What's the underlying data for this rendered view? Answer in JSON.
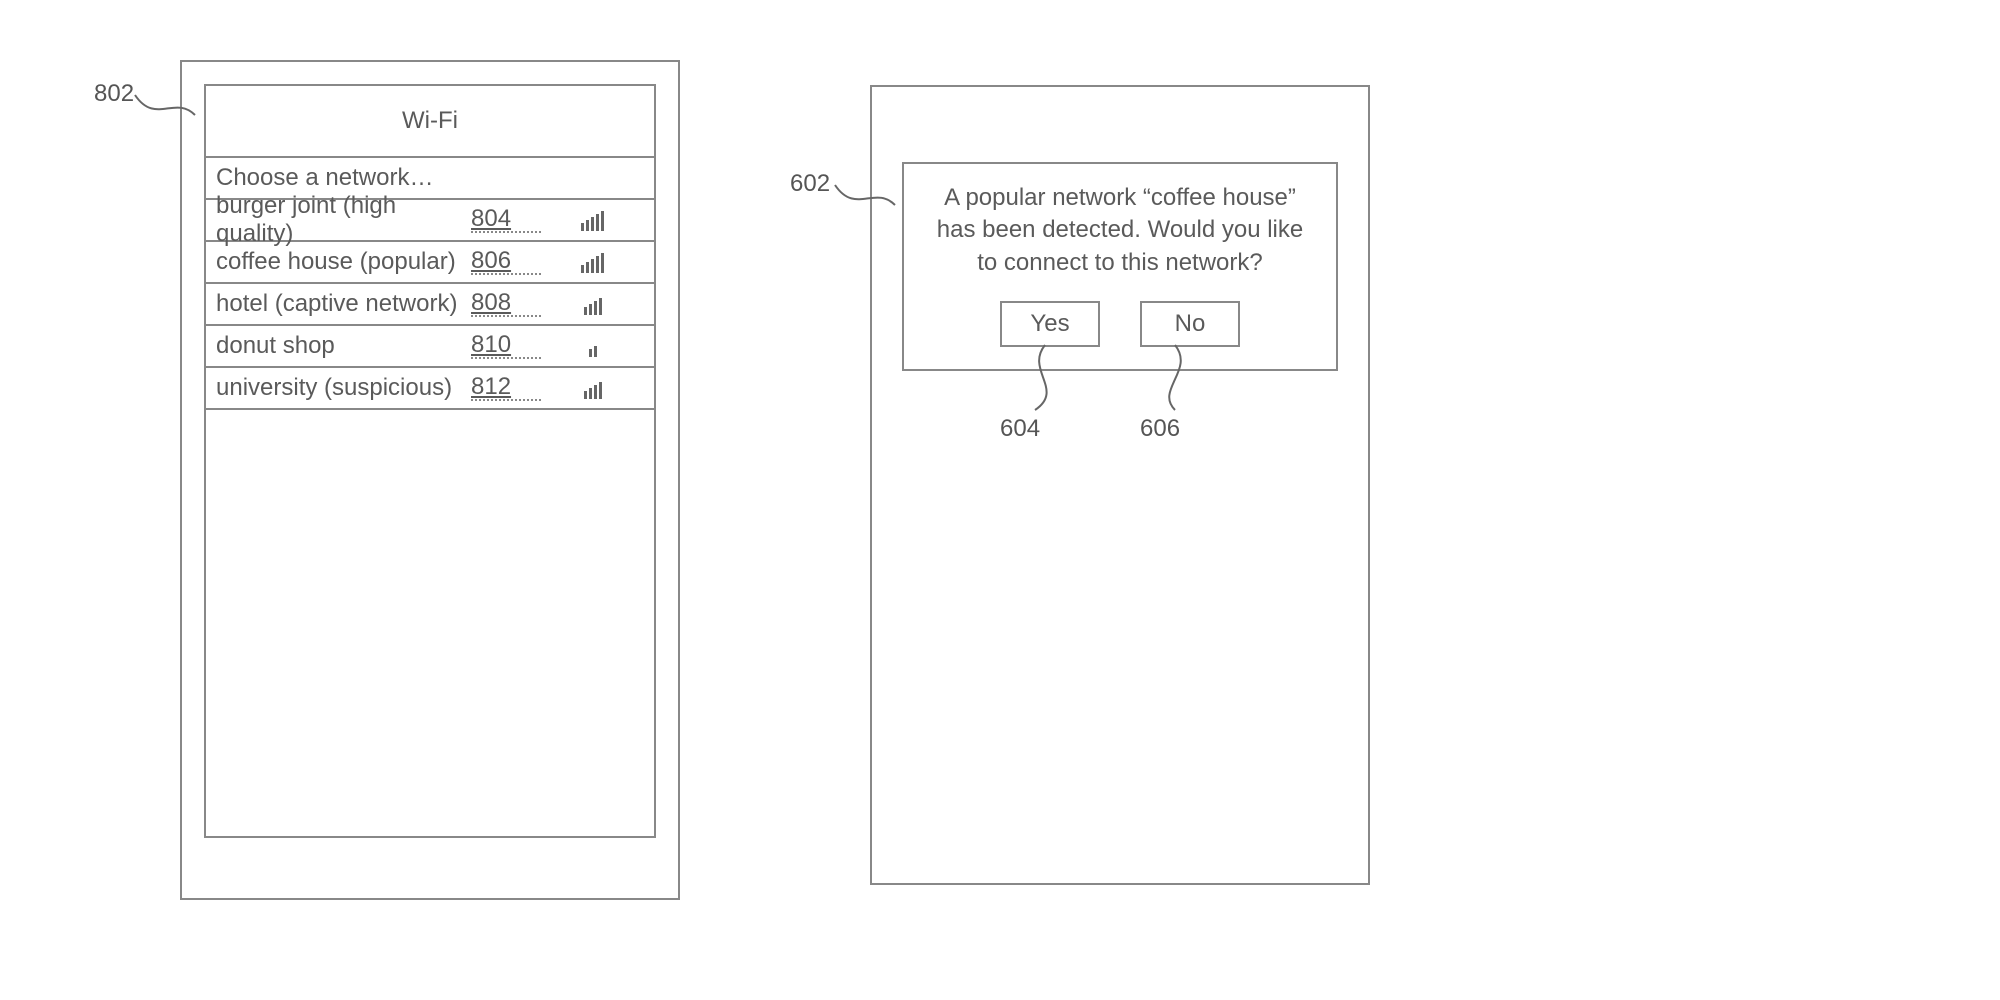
{
  "left": {
    "ref": "802",
    "title": "Wi-Fi",
    "prompt": "Choose a network…",
    "networks": [
      {
        "name": "burger joint (high quality)",
        "ref": "804",
        "bars": 5
      },
      {
        "name": "coffee house (popular)",
        "ref": "806",
        "bars": 5
      },
      {
        "name": "hotel (captive network)",
        "ref": "808",
        "bars": 4
      },
      {
        "name": "donut shop",
        "ref": "810",
        "bars": 2
      },
      {
        "name": "university (suspicious)",
        "ref": "812",
        "bars": 4
      }
    ]
  },
  "right": {
    "ref": "602",
    "message": "A popular network “coffee house” has been detected. Would you like to connect to this network?",
    "yes": {
      "label": "Yes",
      "ref": "604"
    },
    "no": {
      "label": "No",
      "ref": "606"
    }
  }
}
